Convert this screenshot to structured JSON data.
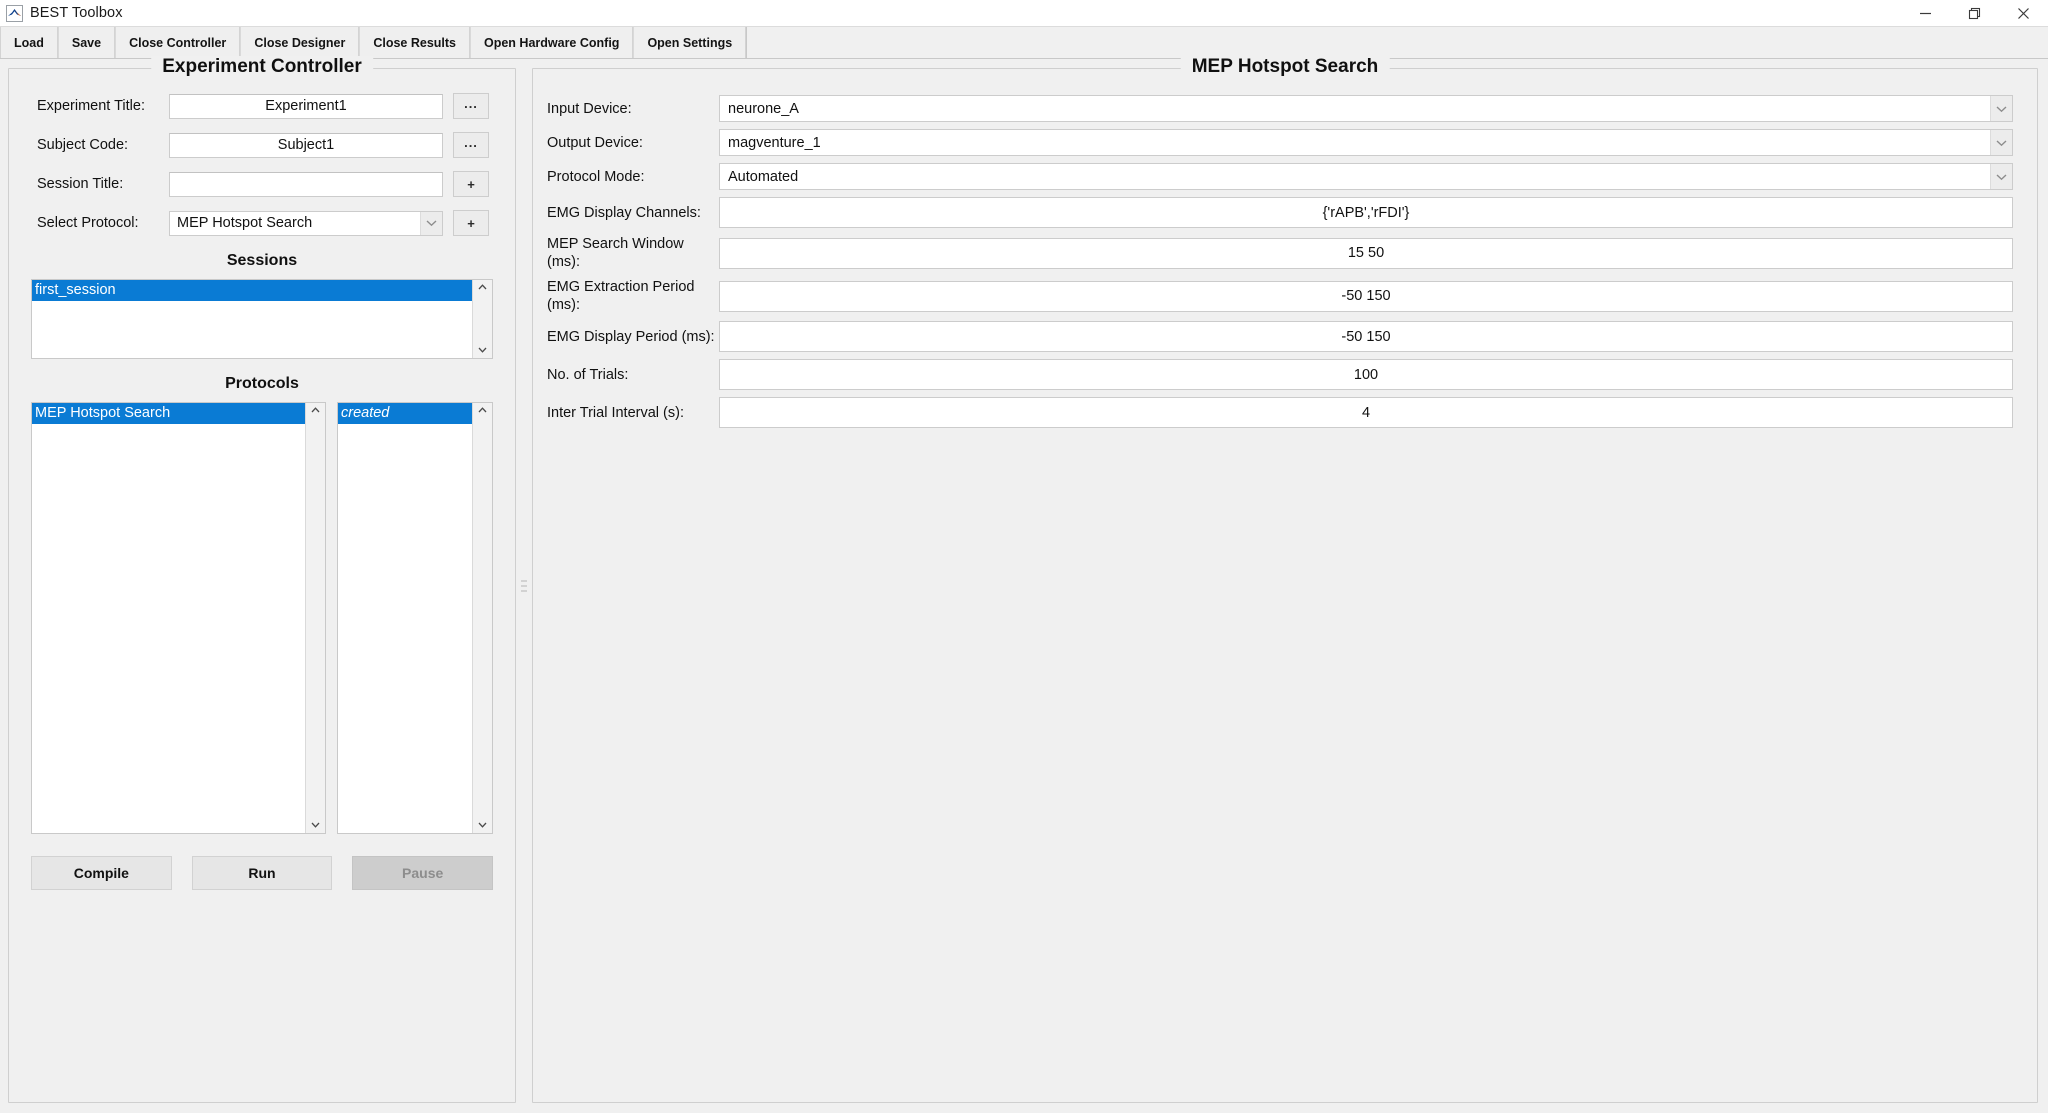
{
  "window": {
    "title": "BEST Toolbox",
    "icon": "matlab-icon",
    "controls": [
      {
        "name": "minimize-button",
        "glyph": "minimize-icon"
      },
      {
        "name": "restore-button",
        "glyph": "restore-icon"
      },
      {
        "name": "close-button",
        "glyph": "close-icon"
      }
    ]
  },
  "toolbar": {
    "buttons": [
      {
        "label": "Load",
        "name": "load-button"
      },
      {
        "label": "Save",
        "name": "save-button"
      },
      {
        "label": "Close Controller",
        "name": "close-controller-button"
      },
      {
        "label": "Close Designer",
        "name": "close-designer-button"
      },
      {
        "label": "Close Results",
        "name": "close-results-button"
      },
      {
        "label": "Open Hardware Config",
        "name": "open-hardware-config-button"
      },
      {
        "label": "Open Settings",
        "name": "open-settings-button"
      }
    ]
  },
  "left_panel": {
    "title": "Experiment Controller",
    "fields": [
      {
        "label": "Experiment Title:",
        "value": "Experiment1",
        "button": "...",
        "type": "text"
      },
      {
        "label": "Subject Code:",
        "value": "Subject1",
        "button": "...",
        "type": "text"
      },
      {
        "label": "Session Title:",
        "value": "",
        "button": "+",
        "type": "text"
      },
      {
        "label": "Select Protocol:",
        "value": "MEP Hotspot Search",
        "button": "+",
        "type": "dropdown"
      }
    ],
    "sessions": {
      "heading": "Sessions",
      "items": [
        {
          "label": "first_session",
          "selected": true,
          "italic": false
        }
      ]
    },
    "protocols": {
      "heading": "Protocols",
      "list": [
        {
          "label": "MEP Hotspot Search",
          "selected": true,
          "italic": false
        }
      ],
      "status_list": [
        {
          "label": "created",
          "selected": true,
          "italic": true
        }
      ]
    },
    "actions": [
      {
        "label": "Compile",
        "name": "compile-button",
        "disabled": false
      },
      {
        "label": "Run",
        "name": "run-button",
        "disabled": false
      },
      {
        "label": "Pause",
        "name": "pause-button",
        "disabled": true
      }
    ]
  },
  "right_panel": {
    "title": "MEP Hotspot Search",
    "fields": [
      {
        "label": "Input Device:",
        "value": "neurone_A",
        "type": "dropdown",
        "align": "left",
        "name": "input-device-field"
      },
      {
        "label": "Output Device:",
        "value": "magventure_1",
        "type": "dropdown",
        "align": "left",
        "name": "output-device-field"
      },
      {
        "label": "Protocol Mode:",
        "value": "Automated",
        "type": "dropdown",
        "align": "left",
        "name": "protocol-mode-field"
      },
      {
        "label": "EMG Display Channels:",
        "value": "{'rAPB','rFDI'}",
        "type": "text",
        "align": "center",
        "name": "emg-display-channels-field"
      },
      {
        "label": "MEP Search Window (ms):",
        "value": "15 50",
        "type": "text",
        "align": "center",
        "name": "mep-search-window-field"
      },
      {
        "label": "EMG Extraction Period (ms):",
        "value": "-50 150",
        "type": "text",
        "align": "center",
        "name": "emg-extraction-period-field"
      },
      {
        "label": "EMG Display Period (ms):",
        "value": "-50 150",
        "type": "text",
        "align": "center",
        "name": "emg-display-period-field"
      },
      {
        "label": "No. of Trials:",
        "value": "100",
        "type": "text",
        "align": "center",
        "name": "no-of-trials-field"
      },
      {
        "label": "Inter Trial Interval (s):",
        "value": "4",
        "type": "text",
        "align": "center",
        "name": "inter-trial-interval-field"
      }
    ]
  },
  "colors": {
    "selection_blue": "#0a7bd4",
    "window_bg": "#f0f0f0",
    "field_bg": "#ffffff",
    "disabled_gray": "#cdcdcd"
  }
}
